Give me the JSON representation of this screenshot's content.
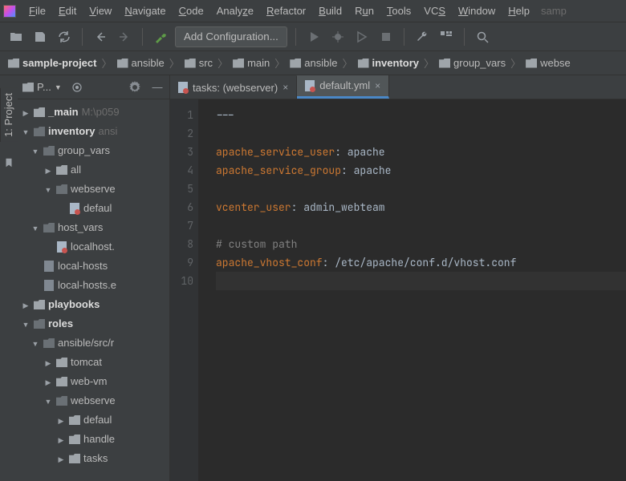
{
  "menu": [
    "File",
    "Edit",
    "View",
    "Navigate",
    "Code",
    "Analyze",
    "Refactor",
    "Build",
    "Run",
    "Tools",
    "VCS",
    "Window",
    "Help"
  ],
  "menu_tail": "samp",
  "toolbar": {
    "add_config": "Add Configuration..."
  },
  "breadcrumb": [
    "sample-project",
    "ansible",
    "src",
    "main",
    "ansible",
    "inventory",
    "group_vars",
    "webse"
  ],
  "panel": {
    "title": "P...",
    "sidebar_label": "1: Project"
  },
  "tree": {
    "main": {
      "label": "_main",
      "hint": "M:\\p059"
    },
    "inventory": {
      "label": "inventory",
      "hint": "ansi"
    },
    "group_vars": "group_vars",
    "all": "all",
    "webserver_dir": "webserve",
    "default_yml": "defaul",
    "host_vars": "host_vars",
    "localhost": "localhost.",
    "local_hosts": "local-hosts",
    "local_hosts_e": "local-hosts.e",
    "playbooks": "playbooks",
    "roles": "roles",
    "roles_path": "ansible/src/r",
    "tomcat": "tomcat",
    "webvm": "web-vm",
    "webserver_role": "webserve",
    "defaults": "defaul",
    "handlers": "handle",
    "tasks": "tasks"
  },
  "tabs": {
    "t1": "tasks: (webserver)",
    "t2": "default.yml"
  },
  "gutter": [
    "1",
    "2",
    "3",
    "4",
    "5",
    "6",
    "7",
    "8",
    "9",
    "10"
  ],
  "code": {
    "l1": "---",
    "l3k": "apache_service_user",
    "l3v": ": apache",
    "l4k": "apache_service_group",
    "l4v": ": apache",
    "l6k": "vcenter_user",
    "l6v": ": admin_webteam",
    "l8c": "# custom path",
    "l9k": "apache_vhost_conf",
    "l9v": ": /etc/apache/conf.d/vhost.conf"
  }
}
